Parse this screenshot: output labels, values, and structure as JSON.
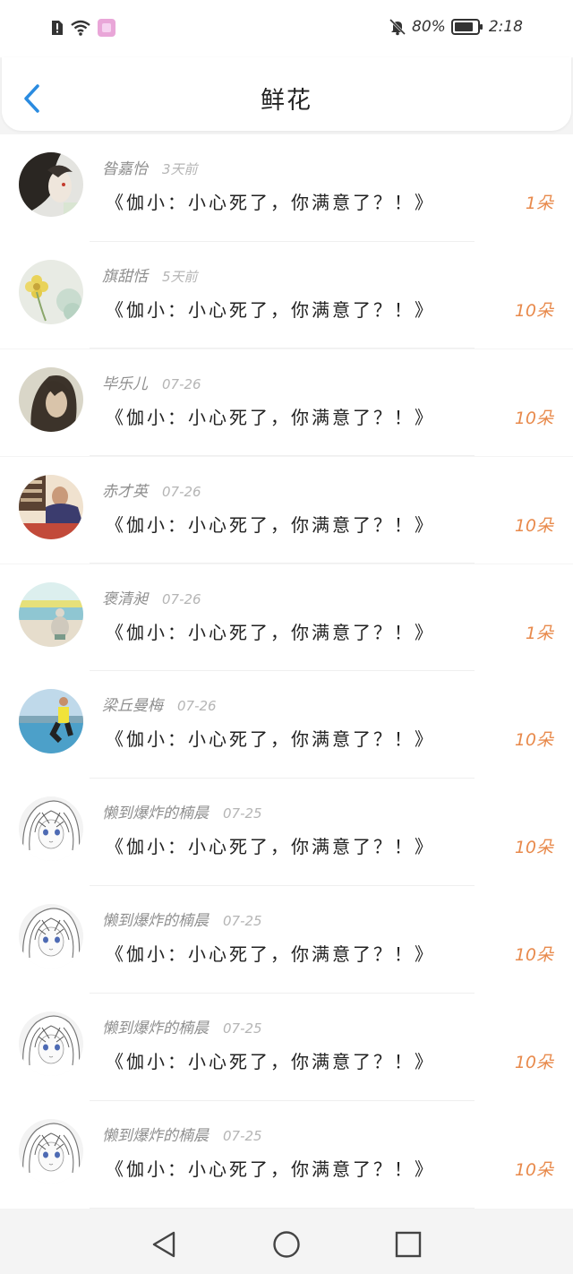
{
  "status_bar": {
    "battery_percent": "80%",
    "time": "2:18",
    "icons": [
      "alert-sim-icon",
      "wifi-icon",
      "app-notification-icon",
      "bell-muted-icon",
      "battery-icon"
    ]
  },
  "header": {
    "title": "鲜花",
    "back_icon": "chevron-left-icon"
  },
  "items": [
    {
      "name": "昝嘉怡",
      "time": "3天前",
      "message": "《伽小：小心死了，你满意了？！》",
      "count": "1朵",
      "avatar": "avatar-girl-dark"
    },
    {
      "name": "旗甜恬",
      "time": "5天前",
      "message": "《伽小：小心死了，你满意了？！》",
      "count": "10朵",
      "avatar": "avatar-flower"
    },
    {
      "name": "毕乐儿",
      "time": "07-26",
      "message": "《伽小：小心死了，你满意了？！》",
      "count": "10朵",
      "avatar": "avatar-girl-portrait"
    },
    {
      "name": "赤才英",
      "time": "07-26",
      "message": "《伽小：小心死了，你满意了？！》",
      "count": "10朵",
      "avatar": "avatar-man-desk"
    },
    {
      "name": "褒清昶",
      "time": "07-26",
      "message": "《伽小：小心死了，你满意了？！》",
      "count": "1朵",
      "avatar": "avatar-beach-snowman"
    },
    {
      "name": "梁丘曼梅",
      "time": "07-26",
      "message": "《伽小：小心死了，你满意了？！》",
      "count": "10朵",
      "avatar": "avatar-runner"
    },
    {
      "name": "懒到爆炸的楠晨",
      "time": "07-25",
      "message": "《伽小：小心死了，你满意了？！》",
      "count": "10朵",
      "avatar": "avatar-anime-sketch"
    },
    {
      "name": "懒到爆炸的楠晨",
      "time": "07-25",
      "message": "《伽小：小心死了，你满意了？！》",
      "count": "10朵",
      "avatar": "avatar-anime-sketch"
    },
    {
      "name": "懒到爆炸的楠晨",
      "time": "07-25",
      "message": "《伽小：小心死了，你满意了？！》",
      "count": "10朵",
      "avatar": "avatar-anime-sketch"
    },
    {
      "name": "懒到爆炸的楠晨",
      "time": "07-25",
      "message": "《伽小：小心死了，你满意了？！》",
      "count": "10朵",
      "avatar": "avatar-anime-sketch"
    }
  ],
  "nav_bar": {
    "icons": [
      "nav-back-icon",
      "nav-home-icon",
      "nav-recents-icon"
    ]
  },
  "colors": {
    "accent_blue": "#2a8be0",
    "count_orange": "#e88a4c"
  }
}
